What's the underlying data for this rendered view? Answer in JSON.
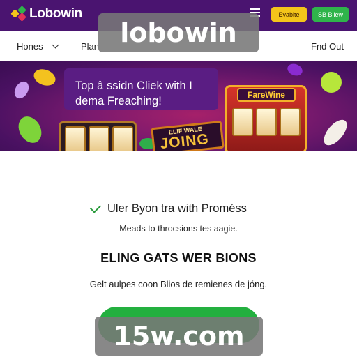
{
  "header": {
    "logo_text": "Lobowin",
    "menu_icon": "menu-icon",
    "yellow_button": "Evabite",
    "green_button": "SB Bliew",
    "colors": {
      "bar": "#4a1470",
      "yellow": "#f4c51a",
      "green": "#2fb44b"
    }
  },
  "nav": {
    "items": [
      "Hones",
      "Plan"
    ],
    "right_item": "Fnd Out"
  },
  "hero": {
    "title": "Top â ssidn Cliek with I dema Freaching!",
    "slot_sign": "FareWine",
    "join_small": "ELIF WALE",
    "join_big": "JOING"
  },
  "content": {
    "check_text": "Uler Byon tra with Proméss",
    "sub_text": "Meads to throcsions tes aagie.",
    "heading": "ELING GATS WER BIONS",
    "description": "Gelt aulpes coon Blios de remienes de jóng."
  },
  "watermarks": {
    "top": "lobowin",
    "bottom": "15w.com"
  }
}
